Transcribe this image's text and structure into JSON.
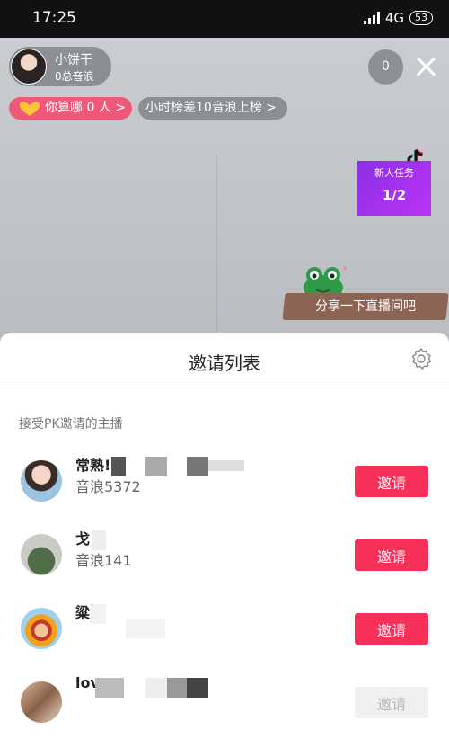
{
  "status_bar": {
    "time": "17:25",
    "network": "4G",
    "battery": "53"
  },
  "live": {
    "host_name": "小饼干",
    "host_sub": "0总音浪",
    "viewer_count": "0",
    "rank_text": "你算哪 0 人 >",
    "hour_rank_text": "小时榜差10音浪上榜 >",
    "task_title": "新人任务",
    "task_count": "1/2",
    "share_text": "分享一下直播间吧"
  },
  "sheet": {
    "title": "邀请列表",
    "section_label": "接受PK邀请的主播",
    "rows": [
      {
        "name": "常熟!",
        "sub": "音浪5372",
        "button": "邀请",
        "enabled": true
      },
      {
        "name": "戈",
        "sub": "音浪141",
        "button": "邀请",
        "enabled": true
      },
      {
        "name": "粱",
        "sub": "",
        "button": "邀请",
        "enabled": true
      },
      {
        "name": "lov",
        "sub": "",
        "button": "邀请",
        "enabled": false
      }
    ]
  },
  "colors": {
    "accent": "#f7305a",
    "task_purple": "#a030f0",
    "rank_pink": "#f0587a"
  }
}
